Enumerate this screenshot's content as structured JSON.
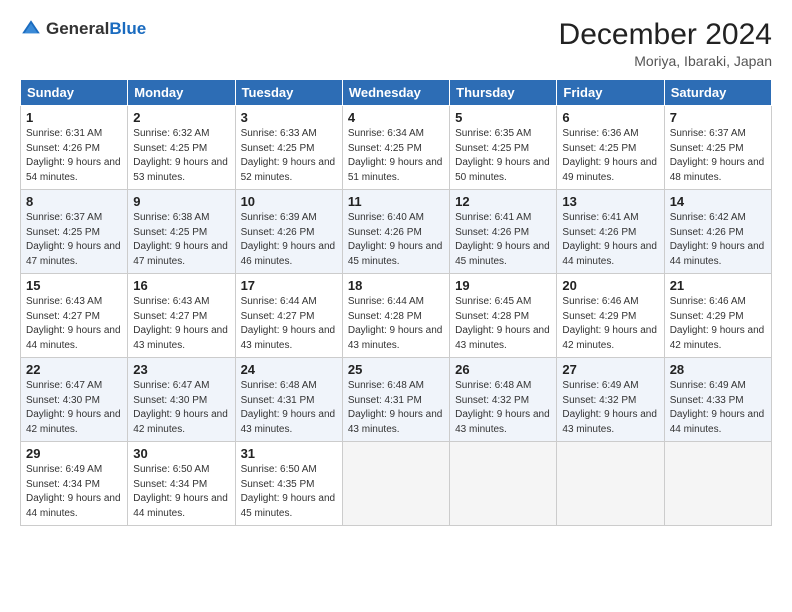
{
  "header": {
    "logo_general": "General",
    "logo_blue": "Blue",
    "title": "December 2024",
    "subtitle": "Moriya, Ibaraki, Japan"
  },
  "weekdays": [
    "Sunday",
    "Monday",
    "Tuesday",
    "Wednesday",
    "Thursday",
    "Friday",
    "Saturday"
  ],
  "weeks": [
    [
      {
        "day": "1",
        "sunrise": "Sunrise: 6:31 AM",
        "sunset": "Sunset: 4:26 PM",
        "daylight": "Daylight: 9 hours and 54 minutes."
      },
      {
        "day": "2",
        "sunrise": "Sunrise: 6:32 AM",
        "sunset": "Sunset: 4:25 PM",
        "daylight": "Daylight: 9 hours and 53 minutes."
      },
      {
        "day": "3",
        "sunrise": "Sunrise: 6:33 AM",
        "sunset": "Sunset: 4:25 PM",
        "daylight": "Daylight: 9 hours and 52 minutes."
      },
      {
        "day": "4",
        "sunrise": "Sunrise: 6:34 AM",
        "sunset": "Sunset: 4:25 PM",
        "daylight": "Daylight: 9 hours and 51 minutes."
      },
      {
        "day": "5",
        "sunrise": "Sunrise: 6:35 AM",
        "sunset": "Sunset: 4:25 PM",
        "daylight": "Daylight: 9 hours and 50 minutes."
      },
      {
        "day": "6",
        "sunrise": "Sunrise: 6:36 AM",
        "sunset": "Sunset: 4:25 PM",
        "daylight": "Daylight: 9 hours and 49 minutes."
      },
      {
        "day": "7",
        "sunrise": "Sunrise: 6:37 AM",
        "sunset": "Sunset: 4:25 PM",
        "daylight": "Daylight: 9 hours and 48 minutes."
      }
    ],
    [
      {
        "day": "8",
        "sunrise": "Sunrise: 6:37 AM",
        "sunset": "Sunset: 4:25 PM",
        "daylight": "Daylight: 9 hours and 47 minutes."
      },
      {
        "day": "9",
        "sunrise": "Sunrise: 6:38 AM",
        "sunset": "Sunset: 4:25 PM",
        "daylight": "Daylight: 9 hours and 47 minutes."
      },
      {
        "day": "10",
        "sunrise": "Sunrise: 6:39 AM",
        "sunset": "Sunset: 4:26 PM",
        "daylight": "Daylight: 9 hours and 46 minutes."
      },
      {
        "day": "11",
        "sunrise": "Sunrise: 6:40 AM",
        "sunset": "Sunset: 4:26 PM",
        "daylight": "Daylight: 9 hours and 45 minutes."
      },
      {
        "day": "12",
        "sunrise": "Sunrise: 6:41 AM",
        "sunset": "Sunset: 4:26 PM",
        "daylight": "Daylight: 9 hours and 45 minutes."
      },
      {
        "day": "13",
        "sunrise": "Sunrise: 6:41 AM",
        "sunset": "Sunset: 4:26 PM",
        "daylight": "Daylight: 9 hours and 44 minutes."
      },
      {
        "day": "14",
        "sunrise": "Sunrise: 6:42 AM",
        "sunset": "Sunset: 4:26 PM",
        "daylight": "Daylight: 9 hours and 44 minutes."
      }
    ],
    [
      {
        "day": "15",
        "sunrise": "Sunrise: 6:43 AM",
        "sunset": "Sunset: 4:27 PM",
        "daylight": "Daylight: 9 hours and 44 minutes."
      },
      {
        "day": "16",
        "sunrise": "Sunrise: 6:43 AM",
        "sunset": "Sunset: 4:27 PM",
        "daylight": "Daylight: 9 hours and 43 minutes."
      },
      {
        "day": "17",
        "sunrise": "Sunrise: 6:44 AM",
        "sunset": "Sunset: 4:27 PM",
        "daylight": "Daylight: 9 hours and 43 minutes."
      },
      {
        "day": "18",
        "sunrise": "Sunrise: 6:44 AM",
        "sunset": "Sunset: 4:28 PM",
        "daylight": "Daylight: 9 hours and 43 minutes."
      },
      {
        "day": "19",
        "sunrise": "Sunrise: 6:45 AM",
        "sunset": "Sunset: 4:28 PM",
        "daylight": "Daylight: 9 hours and 43 minutes."
      },
      {
        "day": "20",
        "sunrise": "Sunrise: 6:46 AM",
        "sunset": "Sunset: 4:29 PM",
        "daylight": "Daylight: 9 hours and 42 minutes."
      },
      {
        "day": "21",
        "sunrise": "Sunrise: 6:46 AM",
        "sunset": "Sunset: 4:29 PM",
        "daylight": "Daylight: 9 hours and 42 minutes."
      }
    ],
    [
      {
        "day": "22",
        "sunrise": "Sunrise: 6:47 AM",
        "sunset": "Sunset: 4:30 PM",
        "daylight": "Daylight: 9 hours and 42 minutes."
      },
      {
        "day": "23",
        "sunrise": "Sunrise: 6:47 AM",
        "sunset": "Sunset: 4:30 PM",
        "daylight": "Daylight: 9 hours and 42 minutes."
      },
      {
        "day": "24",
        "sunrise": "Sunrise: 6:48 AM",
        "sunset": "Sunset: 4:31 PM",
        "daylight": "Daylight: 9 hours and 43 minutes."
      },
      {
        "day": "25",
        "sunrise": "Sunrise: 6:48 AM",
        "sunset": "Sunset: 4:31 PM",
        "daylight": "Daylight: 9 hours and 43 minutes."
      },
      {
        "day": "26",
        "sunrise": "Sunrise: 6:48 AM",
        "sunset": "Sunset: 4:32 PM",
        "daylight": "Daylight: 9 hours and 43 minutes."
      },
      {
        "day": "27",
        "sunrise": "Sunrise: 6:49 AM",
        "sunset": "Sunset: 4:32 PM",
        "daylight": "Daylight: 9 hours and 43 minutes."
      },
      {
        "day": "28",
        "sunrise": "Sunrise: 6:49 AM",
        "sunset": "Sunset: 4:33 PM",
        "daylight": "Daylight: 9 hours and 44 minutes."
      }
    ],
    [
      {
        "day": "29",
        "sunrise": "Sunrise: 6:49 AM",
        "sunset": "Sunset: 4:34 PM",
        "daylight": "Daylight: 9 hours and 44 minutes."
      },
      {
        "day": "30",
        "sunrise": "Sunrise: 6:50 AM",
        "sunset": "Sunset: 4:34 PM",
        "daylight": "Daylight: 9 hours and 44 minutes."
      },
      {
        "day": "31",
        "sunrise": "Sunrise: 6:50 AM",
        "sunset": "Sunset: 4:35 PM",
        "daylight": "Daylight: 9 hours and 45 minutes."
      },
      null,
      null,
      null,
      null
    ]
  ]
}
